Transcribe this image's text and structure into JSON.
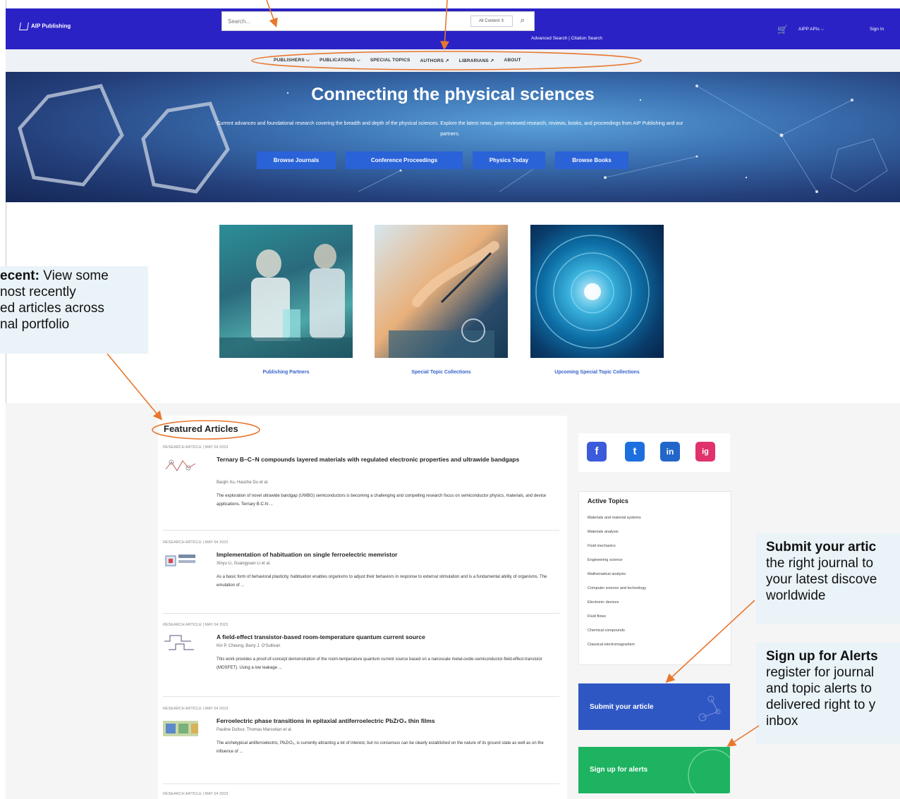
{
  "header": {
    "logo_text": "AIP Publishing",
    "search_placeholder": "Search...",
    "search_scope": "All Content",
    "advanced_links": "Advanced Search | Citation Search",
    "apis_label": "AIPP APIs",
    "signin_label": "Sign In"
  },
  "nav": {
    "items": [
      "PUBLISHERS ⌵",
      "PUBLICATIONS ⌵",
      "SPECIAL TOPICS",
      "AUTHORS ↗",
      "LIBRARIANS ↗",
      "ABOUT"
    ]
  },
  "hero": {
    "title": "Connecting the physical sciences",
    "subtitle": "Current advances and foundational research covering the breadth and depth of the physical sciences. Explore the latest news, peer-reviewed research, reviews, books, and proceedings from AIP Publishing and our partners.",
    "buttons": [
      "Browse Journals",
      "Conference Proceedings",
      "Physics Today",
      "Browse Books"
    ]
  },
  "tiles": [
    "Publishing Partners",
    "Special Topic Collections",
    "Upcoming Special Topic Collections"
  ],
  "featured": {
    "title": "Featured Articles",
    "articles": [
      {
        "meta": "RESEARCH ARTICLE | MAY 04 2023",
        "title": "Ternary B–C–N compounds layered materials with regulated electronic properties and ultrawide bandgaps",
        "authors": "Baojin Xu, Haozhe Du et al.",
        "abstract": "The exploration of novel ultrawide bandgap (UWBG) semiconductors is becoming a challenging and compelling research focus on semiconductor physics, materials, and device applications. Ternary B-C-N ..."
      },
      {
        "meta": "RESEARCH ARTICLE | MAY 04 2023",
        "title": "Implementation of habituation on single ferroelectric memristor",
        "authors": "Xinyu Li, Guangyuan Li et al.",
        "abstract": "As a basic form of behavioral plasticity, habituation enables organisms to adjust their behaviors in response to external stimulation and is a fundamental ability of organisms. The emulation of ..."
      },
      {
        "meta": "RESEARCH ARTICLE | MAY 04 2023",
        "title": "A field-effect transistor-based room-temperature quantum current source",
        "authors": "Kin P. Cheung, Barry J. O'Sullivan",
        "abstract": "This work provides a proof-of-concept demonstration of the room-temperature quantum current source based on a nanoscale metal-oxide-semiconductor-field-effect-transistor (MOSFET). Using a low leakage ..."
      },
      {
        "meta": "RESEARCH ARTICLE | MAY 04 2023",
        "title": "Ferroelectric phase transitions in epitaxial antiferroelectric PbZrO₃ thin films",
        "authors": "Pauline Dufour, Thomas Maroutian et al.",
        "abstract": "The archetypical antiferroelectric, PbZrO₃, is currently attracting a lot of interest, but no consensus can be clearly established on the nature of its ground state as well as on the influence of ..."
      }
    ],
    "last_meta": "RESEARCH ARTICLE | MAY 04 2023"
  },
  "sidebar": {
    "social": [
      "f",
      "t",
      "in",
      "ig"
    ],
    "social_colors": [
      "#3b5bdb",
      "#1d6fe0",
      "#2266c9",
      "#e0336b"
    ],
    "topics_title": "Active Topics",
    "topics": [
      "Materials and material systems",
      "Materials analysis",
      "Fluid mechanics",
      "Engineering science",
      "Mathematical analysis",
      "Computer science and technology",
      "Electronic devices",
      "Fluid flows",
      "Chemical compounds",
      "Classical electromagnetism"
    ],
    "submit_label": "Submit your article",
    "alerts_label": "Sign up for alerts"
  },
  "callouts": {
    "recent": {
      "bold": "ecent:",
      "lines": [
        "View some",
        "nost recently",
        "ed articles across",
        "nal portfolio"
      ]
    },
    "submit": {
      "bold": "Submit your artic",
      "lines": [
        "the right journal to",
        "your latest discove",
        "worldwide"
      ]
    },
    "alerts": {
      "bold": "Sign up for Alerts",
      "lines": [
        "register for journal",
        "and topic alerts to",
        "delivered right to y",
        "inbox"
      ]
    }
  },
  "colors": {
    "brand_blue": "#2b22c6",
    "button_blue": "#2a62d8",
    "link_blue": "#3562c9",
    "submit_blue": "#2f57c4",
    "alerts_green": "#1db360",
    "annotation_orange": "#e8772e"
  }
}
